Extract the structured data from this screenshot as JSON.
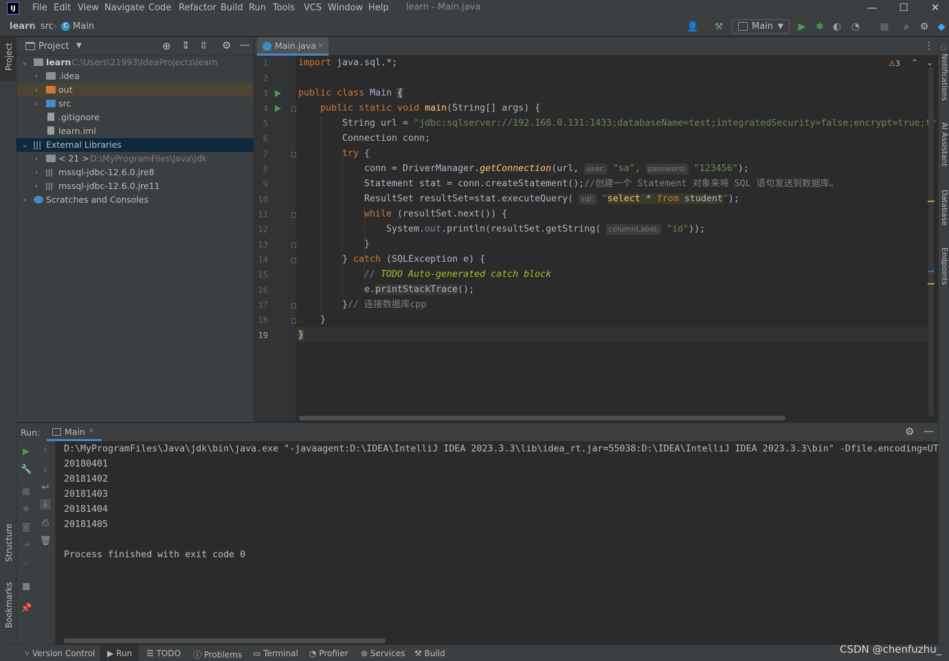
{
  "menubar": {
    "logo": "IJ",
    "items": [
      "File",
      "Edit",
      "View",
      "Navigate",
      "Code",
      "Refactor",
      "Build",
      "Run",
      "Tools",
      "VCS",
      "Window",
      "Help"
    ],
    "window_title": "learn - Main.java",
    "controls": [
      "—",
      "☐",
      "✕"
    ]
  },
  "navbar": {
    "crumbs": [
      "learn",
      "src",
      "Main"
    ],
    "run_config": "Main"
  },
  "left_stripe": {
    "top": "Project",
    "structure": "Structure",
    "bookmarks": "Bookmarks"
  },
  "right_stripe": {
    "notifications": "Notifications",
    "ai": "AI Assistant",
    "database": "Database",
    "endpoints": "Endpoints"
  },
  "project": {
    "title": "Project",
    "tree": [
      {
        "label": "learn",
        "path": "C:\\Users\\21993\\IdeaProjects\\learn"
      },
      {
        "label": ".idea"
      },
      {
        "label": "out"
      },
      {
        "label": "src"
      },
      {
        "label": ".gitignore"
      },
      {
        "label": "learn.iml"
      },
      {
        "label": "External Libraries"
      },
      {
        "label": "< 21 >",
        "path": "D:\\MyProgramFiles\\Java\\jdk"
      },
      {
        "label": "mssql-jdbc-12.6.0.jre8"
      },
      {
        "label": "mssql-jdbc-12.6.0.jre11"
      },
      {
        "label": "Scratches and Consoles"
      }
    ]
  },
  "editor": {
    "tab": "Main.java",
    "warnings": "3",
    "line_numbers": [
      "1",
      "2",
      "3",
      "4",
      "5",
      "6",
      "7",
      "8",
      "9",
      "10",
      "11",
      "12",
      "13",
      "14",
      "15",
      "16",
      "17",
      "18",
      "19"
    ],
    "code": {
      "l1_kw": "import",
      "l1_rest": " java.sql.*;",
      "l3_kw": "public class",
      "l3_name": " Main ",
      "l3_brace": "{",
      "l4_kw": "public static void",
      "l4_fn": " main",
      "l4_rest": "(String[] args) {",
      "l5_a": "String url = ",
      "l5_str": "\"jdbc:sqlserver://192.168.0.131:1433;databaseName=test;integratedSecurity=false;encrypt=true;tr",
      "l6_a": "Connection conn;",
      "l7_kw": "try",
      "l7_rest": " {",
      "l8_a": "conn = DriverManager.",
      "l8_fn": "getConnection",
      "l8_b": "(url, ",
      "l8_hint1": "user:",
      "l8_s1": "\"sa\"",
      "l8_c": ", ",
      "l8_hint2": "password:",
      "l8_s2": "\"123456\"",
      "l8_d": ");",
      "l9_a": "Statement stat = conn.createStatement();",
      "l9_cmt": "//创建一个 Statement 对象来将 SQL 语句发送到数据库。",
      "l10_a": "ResultSet resultSet=stat.executeQuery( ",
      "l10_hint": "sql:",
      "l10_q1": " \"",
      "l10_sql1": "select",
      "l10_sql2": " * ",
      "l10_sql3": "from",
      "l10_sql4": " student",
      "l10_q2": "\"",
      "l10_end": ");",
      "l11_kw": "while",
      "l11_rest": " (resultSet.next()) {",
      "l12_a": "System.",
      "l12_out": "out",
      "l12_b": ".println(resultSet.getString( ",
      "l12_hint": "columnLabel:",
      "l12_s": " \"id\"",
      "l12_c": "));",
      "l13": "}",
      "l14_a": "} ",
      "l14_kw": "catch",
      "l14_rest": " (SQLException e) {",
      "l15_cmt": "// ",
      "l15_todo": "TODO Auto-generated catch block",
      "l16_a": "e.",
      "l16_fn": "printStackTrace",
      "l16_b": "();",
      "l17_a": "}",
      "l17_cmt": "// 连接数据库cpp",
      "l18": "}",
      "l19": "}"
    }
  },
  "run": {
    "label": "Run:",
    "tab": "Main",
    "output": [
      "D:\\MyProgramFiles\\Java\\jdk\\bin\\java.exe \"-javaagent:D:\\IDEA\\IntelliJ IDEA 2023.3.3\\lib\\idea_rt.jar=55038:D:\\IDEA\\IntelliJ IDEA 2023.3.3\\bin\" -Dfile.encoding=UT",
      "20180401",
      "20181402",
      "20181403",
      "20181404",
      "20181405",
      "",
      "Process finished with exit code 0"
    ]
  },
  "statusbar": {
    "items": [
      "Version Control",
      "Run",
      "TODO",
      "Problems",
      "Terminal",
      "Profiler",
      "Services",
      "Build"
    ],
    "watermark": "CSDN @chenfuzhu_"
  },
  "colors": {
    "editor_bg": "#2b2b2b",
    "panel_bg": "#3c3f41",
    "keyword": "#cc7832",
    "string": "#6a8759",
    "function": "#ffc66d",
    "todo": "#a8c023",
    "run_green": "#499c54"
  }
}
